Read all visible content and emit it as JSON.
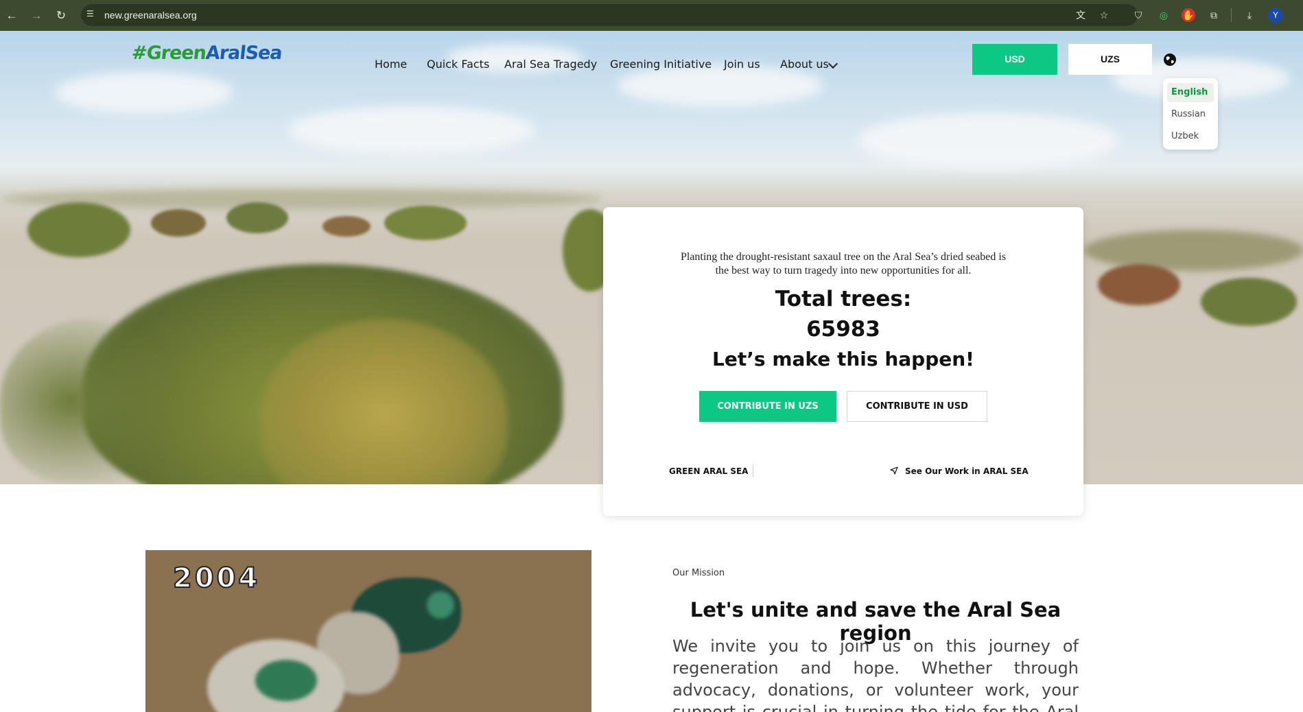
{
  "browser": {
    "url": "new.greenaralsea.org",
    "profile_initial": "Y",
    "icons": [
      "back-icon",
      "forward-icon",
      "reload-icon",
      "site-settings-icon",
      "translate-icon",
      "bookmark-star-icon",
      "shield-extension-icon",
      "green-extension-icon",
      "red-extension-icon",
      "extensions-puzzle-icon",
      "download-icon"
    ]
  },
  "header": {
    "logo_text_green": "#Green",
    "logo_text_blue": "AralSea",
    "nav": [
      "Home",
      "Quick Facts",
      "Aral Sea Tragedy",
      "Greening Initiative",
      "Join us",
      "About us"
    ],
    "currency_usd": "USD",
    "currency_uzs": "UZS",
    "languages": [
      "English",
      "Russian",
      "Uzbek"
    ],
    "active_language": "English"
  },
  "card": {
    "description": "Planting the drought-resistant saxaul tree on the Aral Sea’s dried seabed is the best way to turn tragedy into new opportunities for all.",
    "total_label": "Total trees:",
    "total_value": "65983",
    "cta_heading": "Let’s make this happen!",
    "contribute_uzs": "CONTRIBUTE IN UZS",
    "contribute_usd": "CONTRIBUTE IN USD",
    "footer_left": "GREEN ARAL SEA",
    "footer_right": "See Our Work in ARAL SEA"
  },
  "mission": {
    "image_year": "2004",
    "label": "Our Mission",
    "title": "Let's unite and save the Aral Sea region",
    "body": "We invite you to join us on this journey of regeneration and hope. Whether through advocacy, donations, or volunteer work, your support is crucial in turning the tide for the Aral Sea. Together we can"
  },
  "colors": {
    "accent_green": "#0dc785",
    "browser_chrome": "#3c4a2f"
  }
}
